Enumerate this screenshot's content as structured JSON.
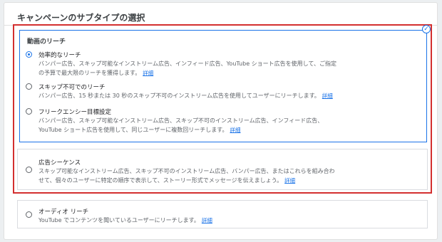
{
  "panel": {
    "title": "キャンペーンのサブタイプの選択"
  },
  "video_reach": {
    "heading": "動画のリーチ",
    "options": [
      {
        "label": "効率的なリーチ",
        "desc1": "バンパー広告、スキップ可能なインストリーム広告、インフィード広告、YouTube ショート広告を使用して、ご指定",
        "desc2": "の予算で最大限のリーチを獲得します。",
        "link": "詳細",
        "selected": true
      },
      {
        "label": "スキップ不可でのリーチ",
        "desc1": "バンパー広告、15 秒または 30 秒のスキップ不可のインストリーム広告を使用してユーザーにリーチします。",
        "link": "詳細",
        "selected": false
      },
      {
        "label": "フリークエンシー目標設定",
        "desc1": "バンパー広告、スキップ可能なインストリーム広告、スキップ不可のインストリーム広告、インフィード広告、",
        "desc2": "YouTube ショート広告を使用して、同じユーザーに複数回リーチします。",
        "link": "詳細",
        "selected": false
      }
    ]
  },
  "sequence": {
    "label": "広告シーケンス",
    "desc1": "スキップ可能なインストリーム広告、スキップ不可のインストリーム広告、バンパー広告、またはこれらを組み合わ",
    "desc2": "せて、個々のユーザーに特定の順序で表示して、ストーリー形式でメッセージを伝えましょう。",
    "link": "詳細",
    "selected": false
  },
  "audio": {
    "label": "オーディオ リーチ",
    "desc1": "YouTube でコンテンツを聞いているユーザーにリーチします。",
    "link": "詳細",
    "selected": false
  },
  "colors": {
    "accent": "#1a73e8",
    "highlight": "#d32f2f"
  },
  "icons": {
    "selected_check": "check-circle-icon"
  }
}
